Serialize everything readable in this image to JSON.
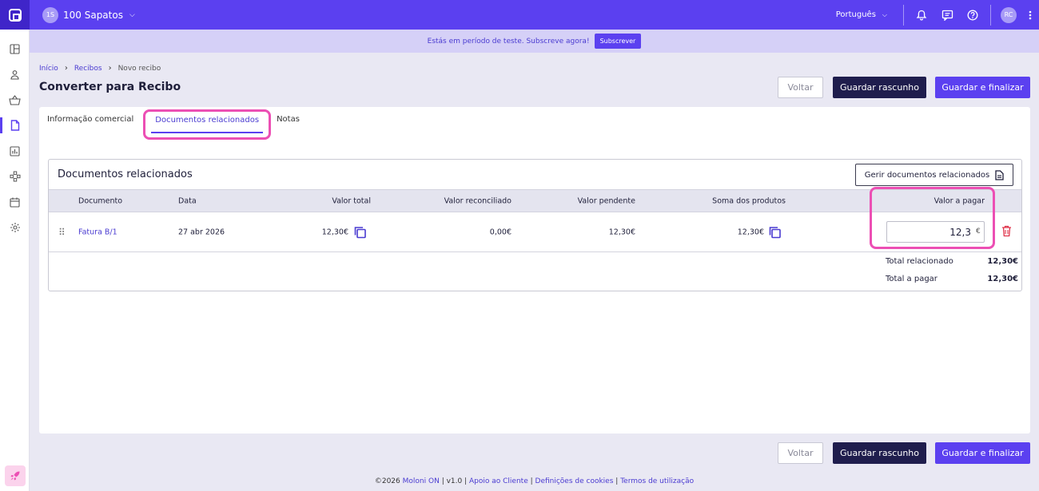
{
  "topbar": {
    "company_initials": "1S",
    "company_name": "100 Sapatos",
    "language": "Português",
    "user_initials": "RC"
  },
  "trial": {
    "message": "Estás em período de teste. Subscreve agora!",
    "button": "Subscrever"
  },
  "breadcrumb": {
    "home": "Início",
    "receipts": "Recibos",
    "current": "Novo recibo"
  },
  "page": {
    "title": "Converter para Recibo"
  },
  "actions": {
    "back": "Voltar",
    "draft": "Guardar rascunho",
    "finalize": "Guardar e finalizar"
  },
  "tabs": [
    {
      "label": "Informação comercial"
    },
    {
      "label": "Documentos relacionados"
    },
    {
      "label": "Notas"
    }
  ],
  "panel": {
    "title": "Documentos relacionados",
    "manage_button": "Gerir documentos relacionados",
    "columns": {
      "document": "Documento",
      "date": "Data",
      "total": "Valor total",
      "reconciled": "Valor reconciliado",
      "pending": "Valor pendente",
      "products_sum": "Soma dos produtos",
      "to_pay": "Valor a pagar"
    },
    "row": {
      "document": "Fatura B/1",
      "date": "27 abr 2026",
      "total": "12,30€",
      "reconciled": "0,00€",
      "pending": "12,30€",
      "products_sum": "12,30€",
      "to_pay": "12,3",
      "currency": "€"
    },
    "totals": {
      "related_label": "Total relacionado",
      "related_value": "12,30€",
      "to_pay_label": "Total a pagar",
      "to_pay_value": "12,30€"
    }
  },
  "footer": {
    "copyright": "©2026",
    "brand": "Moloni ON",
    "version": "v1.0",
    "support": "Apoio ao Cliente",
    "cookies": "Definições de cookies",
    "terms": "Termos de utilização"
  },
  "colors": {
    "brand": "#5b40f0",
    "dark": "#1f1d4d",
    "highlight": "#ec4fb4",
    "delete": "#e0334a"
  }
}
